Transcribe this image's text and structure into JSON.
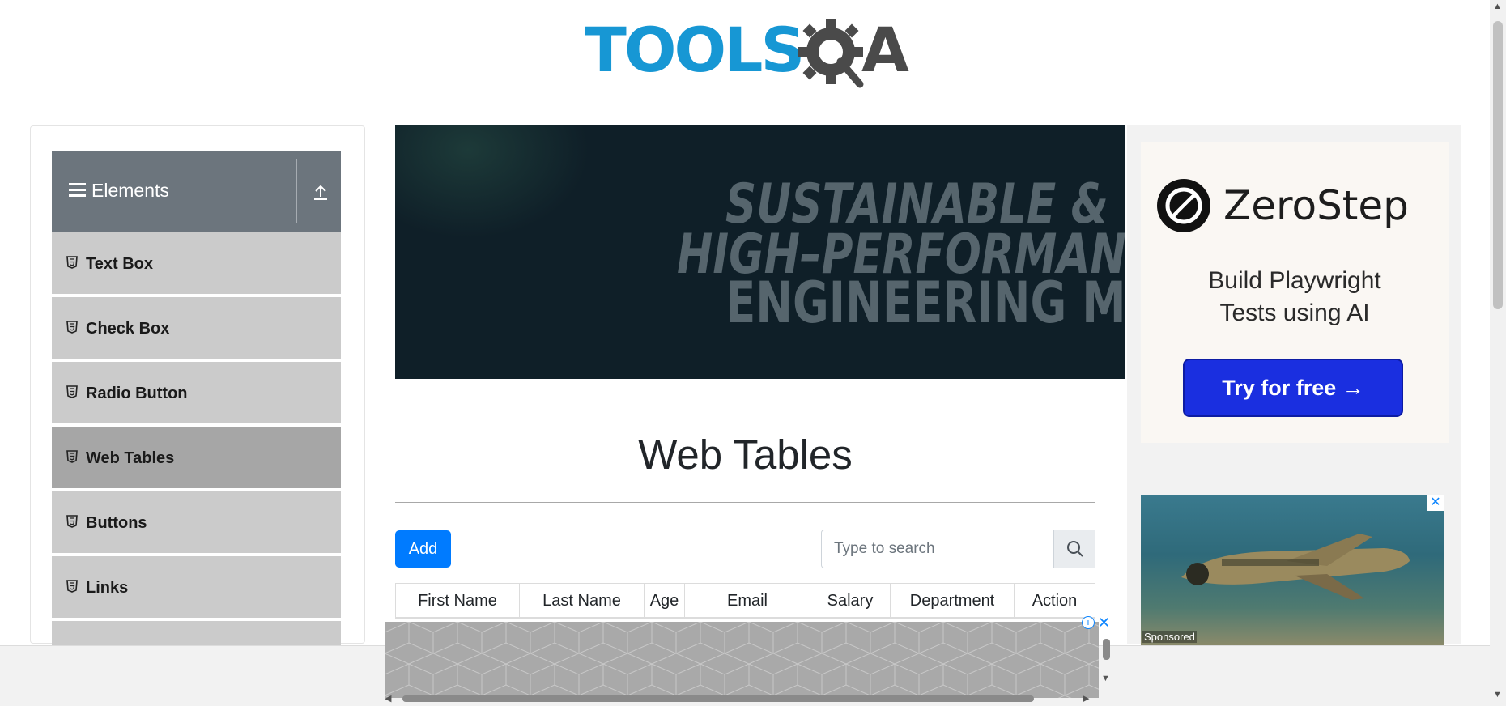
{
  "header": {
    "logo_text_primary": "TOOLS",
    "logo_text_secondary": "A",
    "logo_colors": {
      "primary": "#1797d4",
      "secondary": "#4a4a4a"
    }
  },
  "sidebar": {
    "group_title": "Elements",
    "items": [
      {
        "label": "Text Box",
        "active": false
      },
      {
        "label": "Check Box",
        "active": false
      },
      {
        "label": "Radio Button",
        "active": false
      },
      {
        "label": "Web Tables",
        "active": true
      },
      {
        "label": "Buttons",
        "active": false
      },
      {
        "label": "Links",
        "active": false
      }
    ]
  },
  "banner_ad": {
    "line1": "SUSTAINABLE &",
    "line2": "HIGH–PERFORMANCE",
    "line3": "ENGINEERING MATERIA"
  },
  "main": {
    "title": "Web Tables",
    "add_label": "Add",
    "search": {
      "placeholder": "Type to search",
      "value": ""
    },
    "columns": [
      "First Name",
      "Last Name",
      "Age",
      "Email",
      "Salary",
      "Department",
      "Action"
    ]
  },
  "right_ad": {
    "brand": "ZeroStep",
    "tagline_line1": "Build Playwright",
    "tagline_line2": "Tests using AI",
    "cta": "Try for free →"
  },
  "photo_ad": {
    "sponsored": "Sponsored",
    "close": "✕"
  },
  "sticky_ad": {
    "info": "i",
    "close": "✕"
  },
  "colors": {
    "accent": "#007bff",
    "sidebar_header": "#6c757d",
    "sidebar_item": "#cbcbcb",
    "sidebar_active": "#a6a6a6",
    "cta": "#1a2fe0"
  }
}
